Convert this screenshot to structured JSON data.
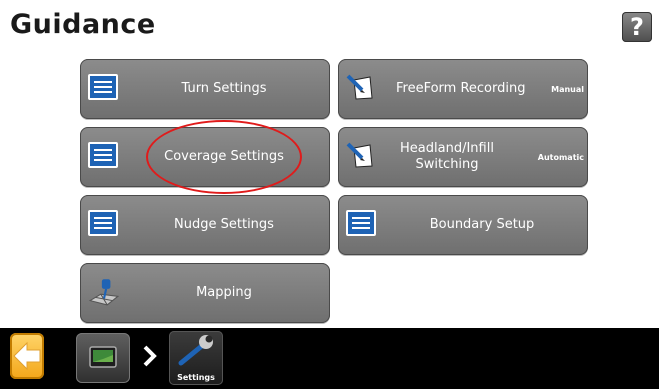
{
  "header": {
    "title": "Guidance",
    "help_label": "?"
  },
  "tiles": [
    {
      "label": "Turn Settings",
      "icon": "list-icon"
    },
    {
      "label": "FreeForm Recording",
      "status": "Manual",
      "icon": "pencil-paper-icon"
    },
    {
      "label": "Coverage Settings",
      "icon": "list-icon"
    },
    {
      "label": "Headland/Infill Switching",
      "status": "Automatic",
      "icon": "pencil-paper-icon"
    },
    {
      "label": "Nudge Settings",
      "icon": "list-icon"
    },
    {
      "label": "Boundary Setup",
      "icon": "list-icon"
    },
    {
      "label": "Mapping",
      "icon": "map-pin-icon"
    }
  ],
  "bottom_bar": {
    "back_icon": "back-arrow-icon",
    "map_icon": "map-display-icon",
    "breadcrumb_label": "Settings",
    "breadcrumb_icon": "wrench-icon"
  },
  "annotation": {
    "color": "#e01b1b"
  }
}
